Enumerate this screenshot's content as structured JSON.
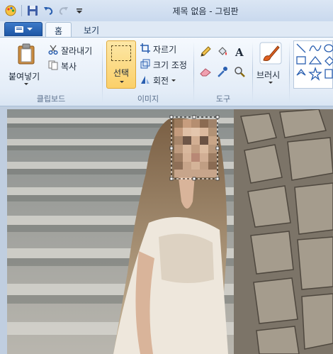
{
  "window": {
    "title": "제목 없음 - 그림판"
  },
  "tabs": [
    {
      "label": "홈",
      "active": true
    },
    {
      "label": "보기",
      "active": false
    }
  ],
  "clipboard": {
    "paste_label": "붙여넣기",
    "cut_label": "잘라내기",
    "copy_label": "복사",
    "group_label": "클립보드"
  },
  "image": {
    "select_label": "선택",
    "crop_label": "자르기",
    "resize_label": "크기 조정",
    "rotate_label": "회전",
    "group_label": "이미지"
  },
  "tools": {
    "group_label": "도구"
  },
  "brush": {
    "label": "브러시"
  },
  "colors": {
    "accent": "#1d56a5",
    "select_highlight": "#fbd06a",
    "ribbon": "#e3ecf7"
  },
  "icons": [
    "paint-app-icon",
    "save-icon",
    "undo-icon",
    "redo-icon",
    "customize-dropdown-icon",
    "pencil-icon",
    "fill-icon",
    "text-icon",
    "eraser-icon",
    "color-picker-icon",
    "magnifier-icon"
  ]
}
